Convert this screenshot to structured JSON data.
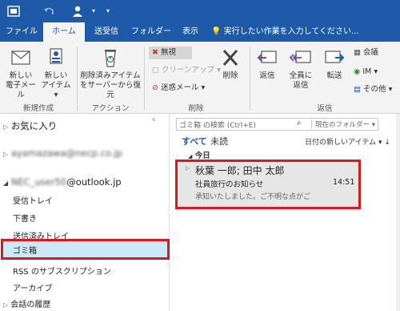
{
  "titlebar": {
    "icons": [
      "outlook-app-icon",
      "undo-icon",
      "person-icon",
      "dropdown-arrow-icon"
    ]
  },
  "tabs": [
    {
      "label": "ファイル",
      "active": false
    },
    {
      "label": "ホーム",
      "active": true
    },
    {
      "label": "送受信",
      "active": false
    },
    {
      "label": "フォルダー",
      "active": false
    },
    {
      "label": "表示",
      "active": false
    }
  ],
  "tell_me": "実行したい作業を入力してください...",
  "ribbon": {
    "new_email": [
      "新しい",
      "電子メール"
    ],
    "new_items": [
      "新しい",
      "アイテム"
    ],
    "restore_deleted": [
      "削除済みアイテム",
      "をサーバーから復元"
    ],
    "ignore": "無視",
    "cleanup": "クリーンアップ",
    "junk": "迷惑メール",
    "delete": "削除",
    "reply": "返信",
    "reply_all": [
      "全員に",
      "返信"
    ],
    "forward": "転送",
    "meeting": "会議",
    "im": "IM",
    "more": "その他",
    "groups": {
      "new": "新規作成",
      "action": "アクション",
      "delete": "削除",
      "respond": "返信"
    }
  },
  "folder_pane": {
    "favorites": "お気に入り",
    "account1_masked": "ayamazawa@necp.co.jp",
    "account2_masked": "NEC_user50",
    "account2_suffix": "@outlook.jp",
    "folders": [
      "受信トレイ",
      "下書き",
      "送信済みトレイ",
      "ゴミ箱",
      "RSS のサブスクリプション",
      "アーカイブ",
      "会話の履歴"
    ],
    "selected": "ゴミ箱"
  },
  "message_list": {
    "search_placeholder": "ゴミ箱 の検索 (Ctrl+E)",
    "scope": "現在のフォルダー",
    "filter_all": "すべて",
    "filter_unread": "未読",
    "sort": "日付の新しいアイテム",
    "group_header": "今日",
    "message": {
      "from": "秋葉 一郎; 田中 太郎",
      "subject": "社員旅行のお知らせ",
      "time": "14:51",
      "preview": "承知いたしました。ご不明な点がご"
    }
  },
  "colors": {
    "accent": "#1e5aa8",
    "highlight_red": "#e3141e",
    "selected_bg": "#cde8f7"
  }
}
